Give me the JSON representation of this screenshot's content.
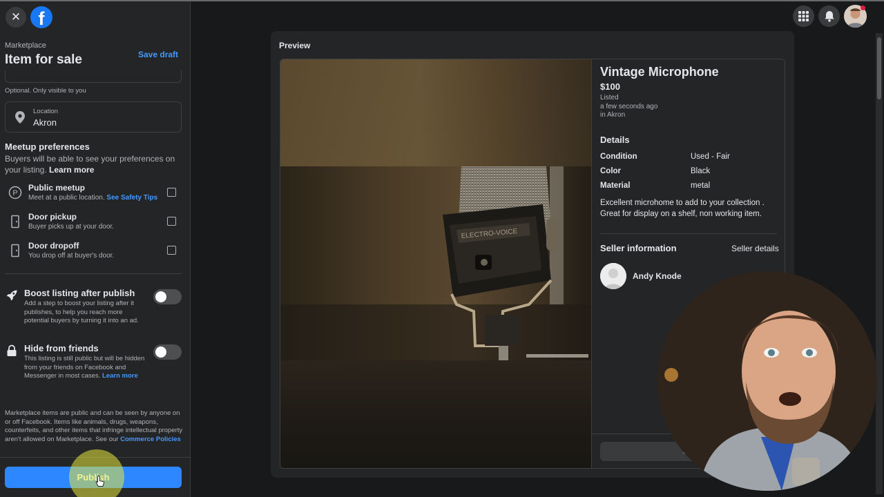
{
  "sidebar": {
    "close_icon": "close-icon",
    "logo_icon": "facebook-logo",
    "logo_letter": "f",
    "section_label": "Marketplace",
    "title": "Item for sale",
    "save_draft": "Save draft",
    "optional_note": "Optional. Only visible to you",
    "location": {
      "label": "Location",
      "value": "Akron"
    },
    "meetup": {
      "title": "Meetup preferences",
      "description": "Buyers will be able to see your preferences on your listing.",
      "learn_more": "Learn more",
      "options": [
        {
          "title": "Public meetup",
          "subtitle": "Meet at a public location.",
          "link": "See Safety Tips",
          "icon": "public-meetup-icon",
          "checked": false
        },
        {
          "title": "Door pickup",
          "subtitle": "Buyer picks up at your door.",
          "icon": "door-icon",
          "checked": false
        },
        {
          "title": "Door dropoff",
          "subtitle": "You drop off at buyer's door.",
          "icon": "door-icon",
          "checked": false
        }
      ]
    },
    "boost": {
      "title": "Boost listing after publish",
      "description": "Add a step to boost your listing after it publishes, to help you reach more potential buyers by turning it into an ad.",
      "enabled": false
    },
    "hide": {
      "title": "Hide from friends",
      "description": "This listing is still public but will be hidden from your friends on Facebook and Messenger in most cases.",
      "learn_more": "Learn more",
      "enabled": false
    },
    "policy_text": "Marketplace items are public and can be seen by anyone on or off Facebook. Items like animals, drugs, weapons, counterfeits, and other items that infringe intellectual property aren't allowed on Marketplace. See our",
    "policy_link": "Commerce Policies",
    "publish": "Publish"
  },
  "topbar": {
    "icons": [
      "apps-grid-icon",
      "bell-icon",
      "account-avatar"
    ]
  },
  "preview": {
    "label": "Preview",
    "item": {
      "title": "Vintage Microphone",
      "price": "$100",
      "listed": "Listed",
      "time": "a few seconds ago",
      "place": "in Akron",
      "details_heading": "Details",
      "details": [
        {
          "key": "Condition",
          "value": "Used - Fair"
        },
        {
          "key": "Color",
          "value": "Black"
        },
        {
          "key": "Material",
          "value": "metal"
        }
      ],
      "description": "Excellent microhome to add to your collection . Great for display on a shelf, non working item.",
      "photo_brand": "ELECTRO-VOICE"
    },
    "seller": {
      "heading": "Seller information",
      "details_link": "Seller details",
      "name": "Andy Knode"
    },
    "message_button": "Me"
  },
  "colors": {
    "accent": "#2d88ff",
    "link": "#4599ff",
    "panel": "#242526",
    "background": "#18191a"
  }
}
